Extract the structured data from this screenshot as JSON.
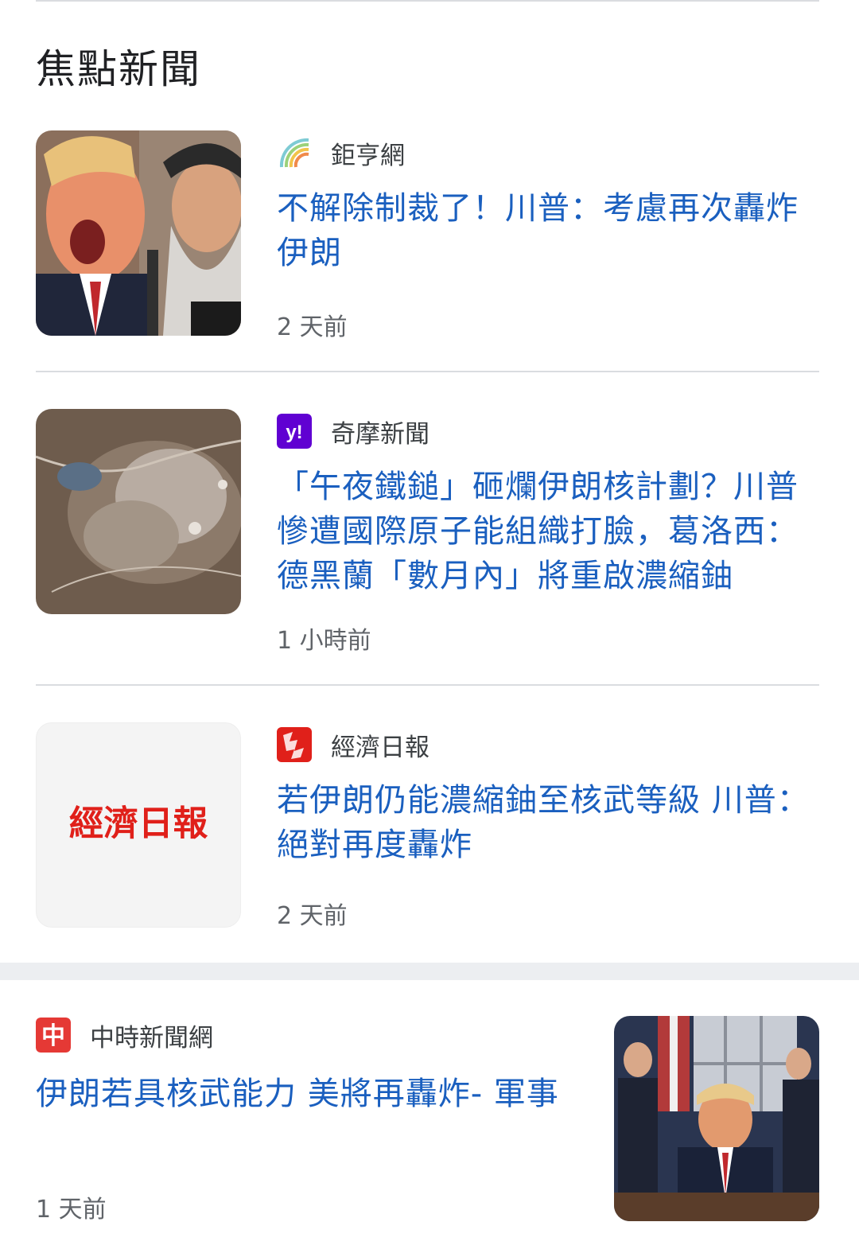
{
  "section": {
    "title": "焦點新聞"
  },
  "articles": [
    {
      "source": "鉅亨網",
      "headline": "不解除制裁了！川普：考慮再次轟炸伊朗",
      "time": "2 天前"
    },
    {
      "source": "奇摩新聞",
      "source_icon_text": "y!",
      "headline": "「午夜鐵鎚」砸爛伊朗核計劃？川普慘遭國際原子能組織打臉，葛洛西：德黑蘭「數月內」將重啟濃縮鈾",
      "time": "1 小時前"
    },
    {
      "source": "經濟日報",
      "headline": "若伊朗仍能濃縮鈾至核武等級 川普：絕對再度轟炸",
      "time": "2 天前",
      "thumb_logo": "經濟日報"
    }
  ],
  "featured": {
    "source": "中時新聞網",
    "source_icon_text": "中",
    "headline": "伊朗若具核武能力 美將再轟炸- 軍事",
    "time": "1 天前"
  },
  "colors": {
    "headline": "#1a5fbf",
    "yahoo_purple": "#6001d2",
    "udn_red": "#e0201a",
    "chinatimes_red": "#e53935"
  }
}
